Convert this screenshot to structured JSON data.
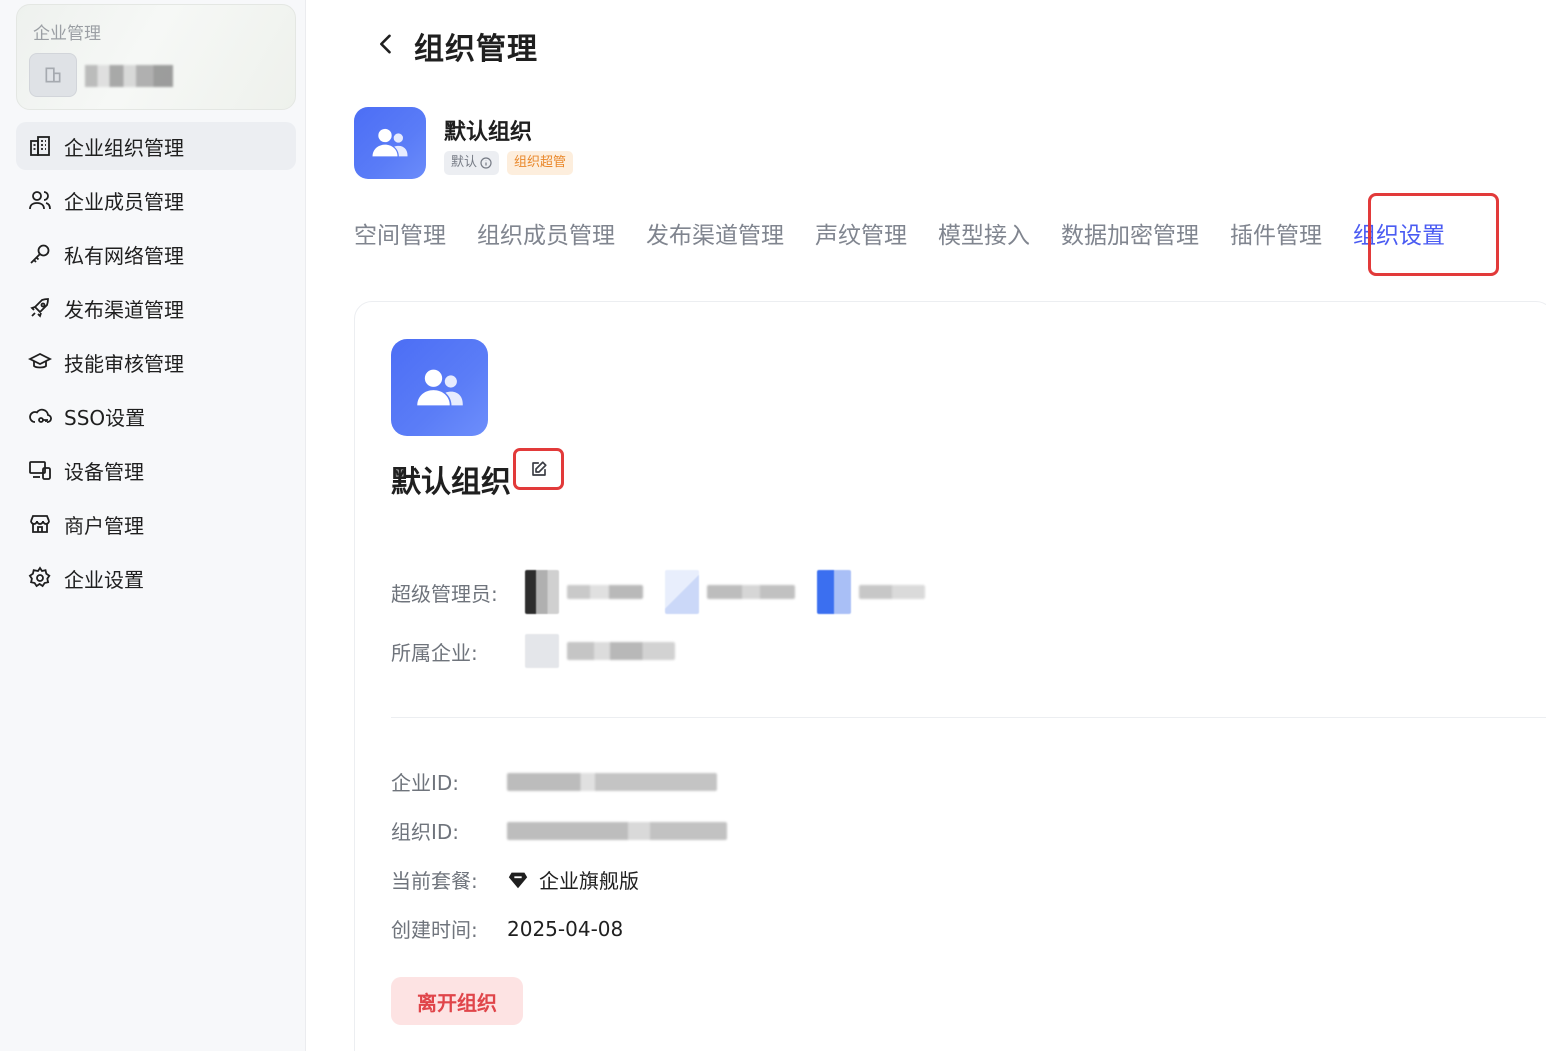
{
  "sidebar": {
    "enterprise_card_title": "企业管理",
    "menu": [
      {
        "label": "企业组织管理",
        "icon": "building-icon",
        "active": true
      },
      {
        "label": "企业成员管理",
        "icon": "users-icon",
        "active": false
      },
      {
        "label": "私有网络管理",
        "icon": "key-icon",
        "active": false
      },
      {
        "label": "发布渠道管理",
        "icon": "rocket-icon",
        "active": false
      },
      {
        "label": "技能审核管理",
        "icon": "graduation-cap-icon",
        "active": false
      },
      {
        "label": "SSO设置",
        "icon": "cloud-key-icon",
        "active": false
      },
      {
        "label": "设备管理",
        "icon": "devices-icon",
        "active": false
      },
      {
        "label": "商户管理",
        "icon": "store-icon",
        "active": false
      },
      {
        "label": "企业设置",
        "icon": "gear-icon",
        "active": false
      }
    ]
  },
  "header": {
    "title": "组织管理"
  },
  "org": {
    "name": "默认组织",
    "tag_default": "默认",
    "tag_super": "组织超管"
  },
  "tabs": [
    {
      "label": "空间管理",
      "active": false
    },
    {
      "label": "组织成员管理",
      "active": false
    },
    {
      "label": "发布渠道管理",
      "active": false
    },
    {
      "label": "声纹管理",
      "active": false
    },
    {
      "label": "模型接入",
      "active": false
    },
    {
      "label": "数据加密管理",
      "active": false
    },
    {
      "label": "插件管理",
      "active": false
    },
    {
      "label": "组织设置",
      "active": true
    }
  ],
  "details": {
    "super_admin_label": "超级管理员:",
    "enterprise_label": "所属企业:",
    "enterprise_id_label": "企业ID:",
    "org_id_label": "组织ID:",
    "plan_label": "当前套餐:",
    "plan_value": "企业旗舰版",
    "created_label": "创建时间:",
    "created_value": "2025-04-08"
  },
  "actions": {
    "leave_label": "离开组织"
  },
  "colors": {
    "accent": "#4a5bf2",
    "highlight_red": "#e23a3a",
    "danger": "#e0454a",
    "super_tag": "#e9882b"
  }
}
